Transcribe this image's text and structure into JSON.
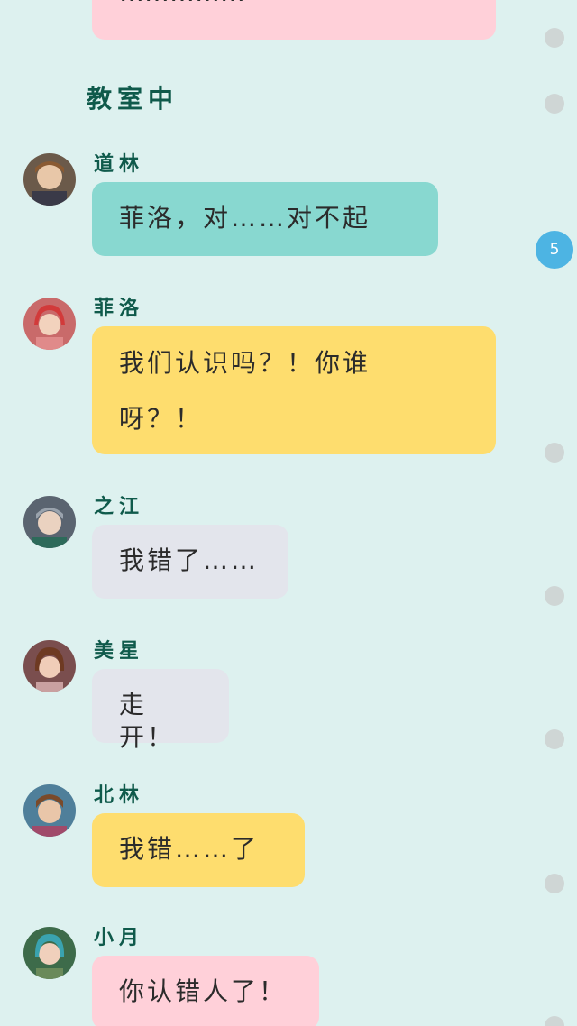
{
  "colors": {
    "background": "#ddf1ef",
    "pink": "#ffd0d9",
    "teal": "#88d8d0",
    "yellow": "#fedd6e",
    "grey": "#e3e5ec",
    "name_text": "#0f5a4b",
    "badge": "#4db4e3"
  },
  "top_bubble": {
    "text": "……………",
    "color": "pink"
  },
  "section_title": "教室中",
  "unread_badge": "5",
  "messages": [
    {
      "name": "道林",
      "text": "菲洛，对……对不起",
      "color": "teal",
      "avatar_icon": "boy-avatar-icon"
    },
    {
      "name": "菲洛",
      "text": "我们认识吗？！你谁呀？！",
      "line1": "我们认识吗？！你谁",
      "line2": "呀？！",
      "color": "yellow",
      "avatar_icon": "girl-red-hair-avatar-icon"
    },
    {
      "name": "之江",
      "text": "我错了……",
      "color": "grey",
      "avatar_icon": "boy-grey-hair-avatar-icon"
    },
    {
      "name": "美星",
      "text": "走开！",
      "color": "grey",
      "avatar_icon": "girl-brown-hair-avatar-icon"
    },
    {
      "name": "北林",
      "text": "我错……了",
      "color": "yellow",
      "avatar_icon": "boy-brown-hair-avatar-icon"
    },
    {
      "name": "小月",
      "text": "你认错人了！",
      "color": "pink",
      "avatar_icon": "girl-teal-hair-avatar-icon"
    }
  ]
}
